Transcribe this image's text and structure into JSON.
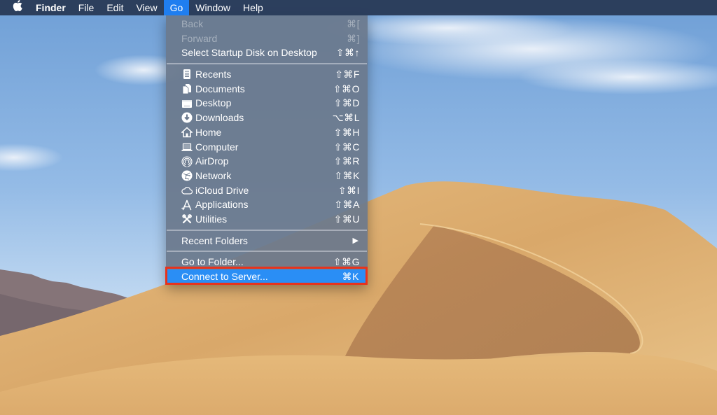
{
  "menubar": {
    "apple_icon": "apple-logo-icon",
    "app_name": "Finder",
    "items": [
      {
        "label": "File"
      },
      {
        "label": "Edit"
      },
      {
        "label": "View"
      },
      {
        "label": "Go",
        "active": true
      },
      {
        "label": "Window"
      },
      {
        "label": "Help"
      }
    ]
  },
  "go_menu": {
    "sections": [
      [
        {
          "label": "Back",
          "shortcut": "⌘[",
          "disabled": true
        },
        {
          "label": "Forward",
          "shortcut": "⌘]",
          "disabled": true
        },
        {
          "label": "Select Startup Disk on Desktop",
          "shortcut": "⇧⌘↑"
        }
      ],
      [
        {
          "label": "Recents",
          "shortcut": "⇧⌘F",
          "icon": "recents-icon"
        },
        {
          "label": "Documents",
          "shortcut": "⇧⌘O",
          "icon": "documents-icon"
        },
        {
          "label": "Desktop",
          "shortcut": "⇧⌘D",
          "icon": "desktop-icon"
        },
        {
          "label": "Downloads",
          "shortcut": "⌥⌘L",
          "icon": "downloads-icon"
        },
        {
          "label": "Home",
          "shortcut": "⇧⌘H",
          "icon": "home-icon"
        },
        {
          "label": "Computer",
          "shortcut": "⇧⌘C",
          "icon": "computer-icon"
        },
        {
          "label": "AirDrop",
          "shortcut": "⇧⌘R",
          "icon": "airdrop-icon"
        },
        {
          "label": "Network",
          "shortcut": "⇧⌘K",
          "icon": "network-icon"
        },
        {
          "label": "iCloud Drive",
          "shortcut": "⇧⌘I",
          "icon": "icloud-icon"
        },
        {
          "label": "Applications",
          "shortcut": "⇧⌘A",
          "icon": "applications-icon"
        },
        {
          "label": "Utilities",
          "shortcut": "⇧⌘U",
          "icon": "utilities-icon"
        }
      ],
      [
        {
          "label": "Recent Folders",
          "submenu_arrow": "▶"
        }
      ],
      [
        {
          "label": "Go to Folder...",
          "shortcut": "⇧⌘G"
        },
        {
          "label": "Connect to Server...",
          "shortcut": "⌘K",
          "highlighted": true
        }
      ]
    ]
  },
  "colors": {
    "menubar_bg": "#263652",
    "active_menu": "#1f7ef0",
    "highlight_row": "#2a8ef5",
    "annotation_box": "#e8331c",
    "sky": "#8fb6e2",
    "sand": "#d9a86a"
  },
  "annotation": {
    "target": "Connect to Server..."
  }
}
